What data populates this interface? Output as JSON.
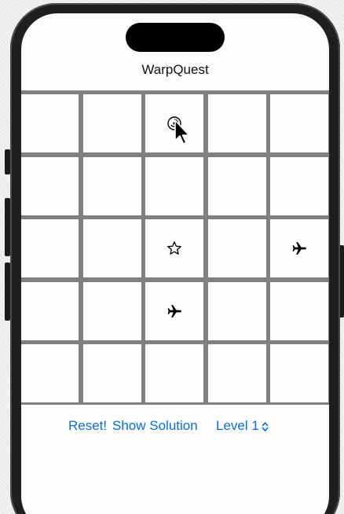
{
  "app": {
    "title": "WarpQuest"
  },
  "board": {
    "rows": 5,
    "cols": 5,
    "cells": [
      [
        "",
        "",
        "portal",
        "",
        ""
      ],
      [
        "",
        "",
        "",
        "",
        ""
      ],
      [
        "",
        "",
        "star",
        "",
        "airplane"
      ],
      [
        "",
        "",
        "airplane",
        "",
        ""
      ],
      [
        "",
        "",
        "",
        "",
        ""
      ]
    ],
    "cursor_cell": [
      0,
      2
    ]
  },
  "controls": {
    "reset_label": "Reset!",
    "solution_label": "Show Solution",
    "level_label": "Level 1",
    "level_icon": "chevron-up-down-icon"
  },
  "colors": {
    "accent": "#0a6fd1",
    "grid_line": "#808083",
    "cell_bg": "#fdfdfd",
    "device_frame": "#1f1f21"
  }
}
